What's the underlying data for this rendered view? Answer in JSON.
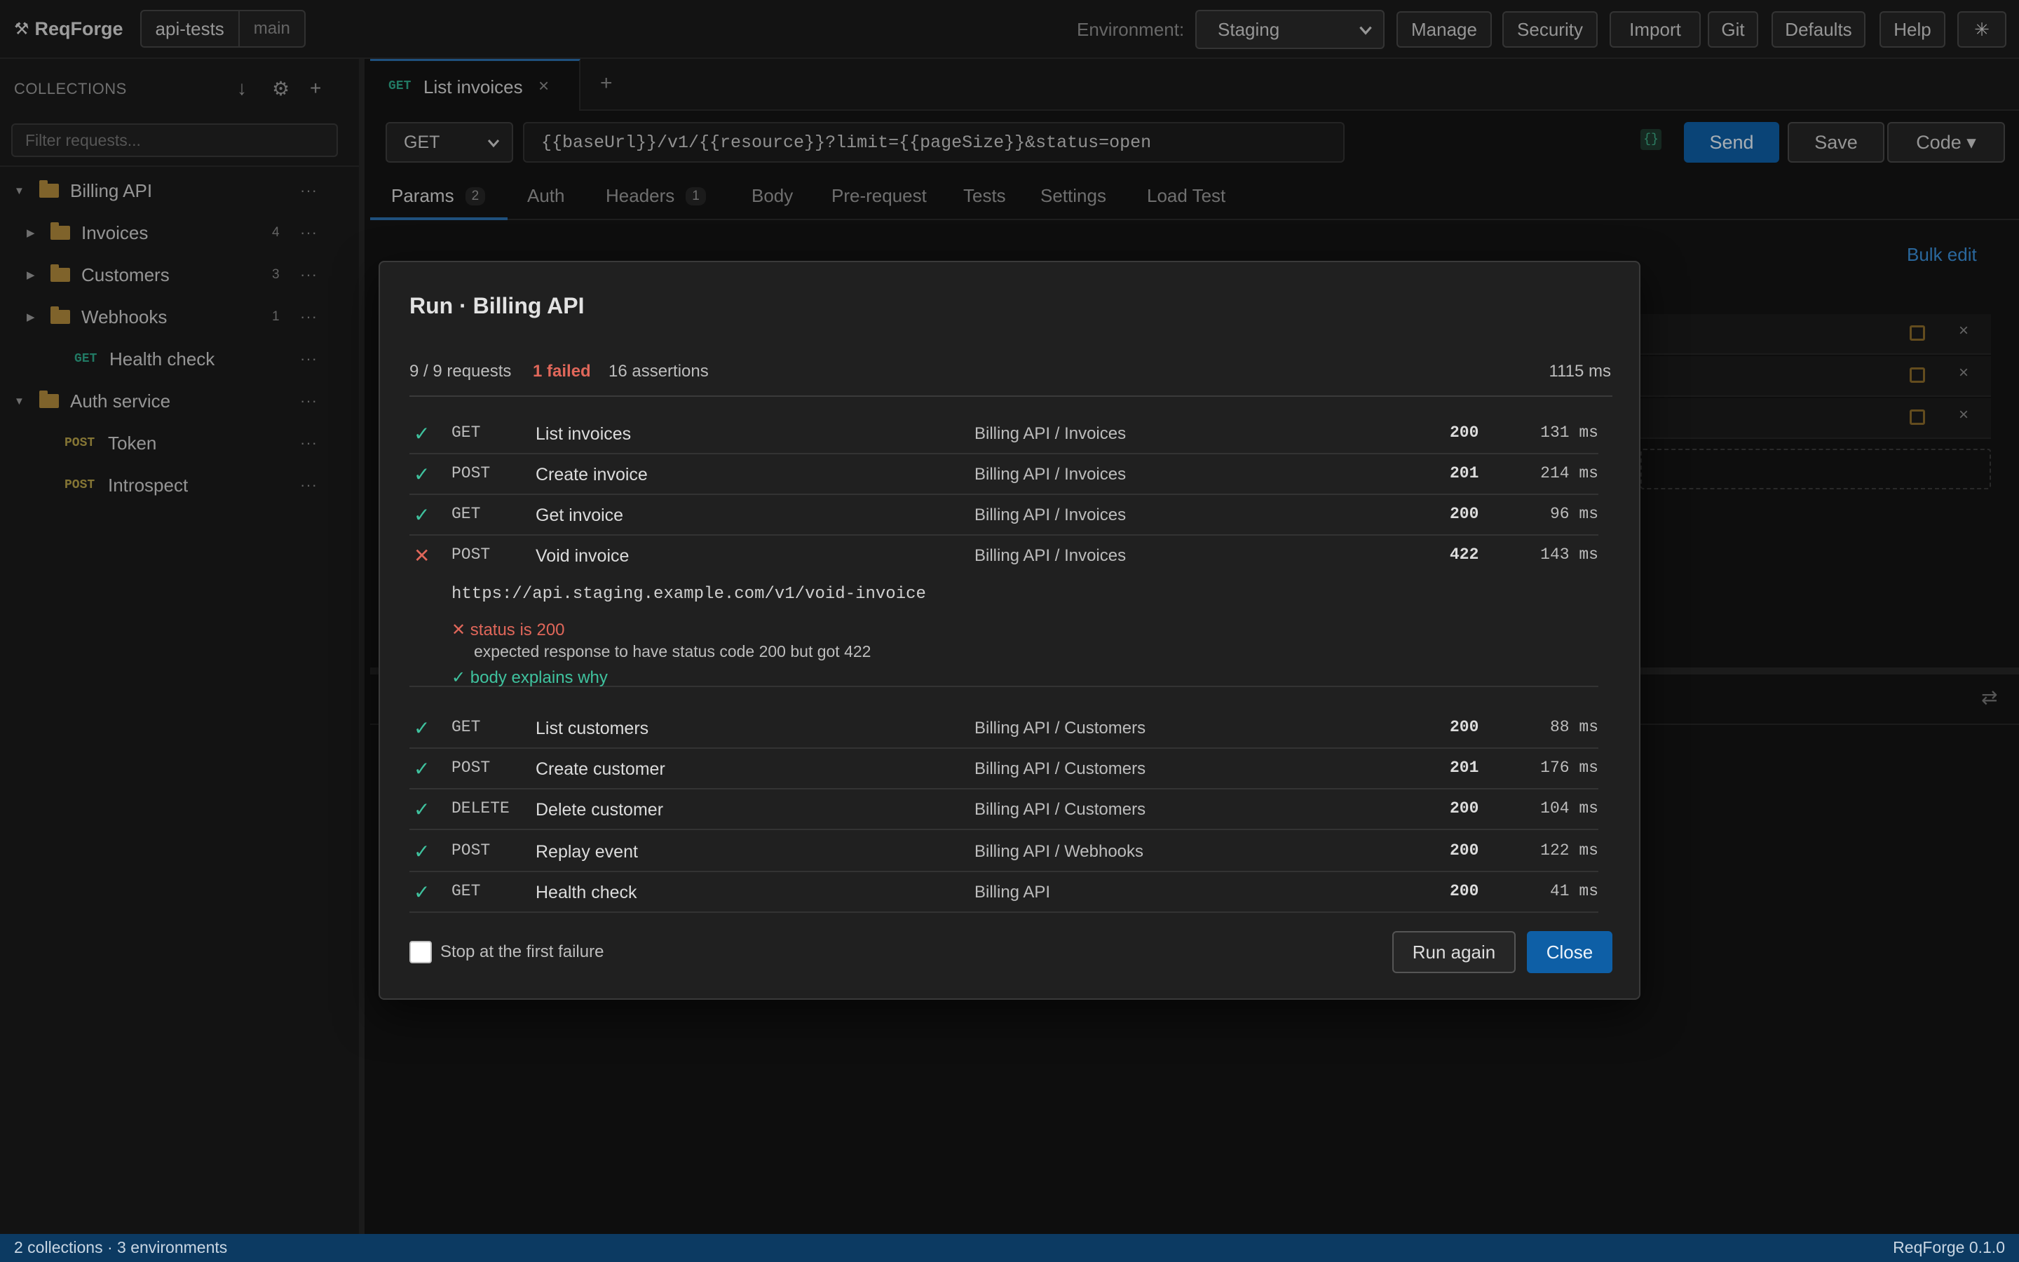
{
  "app": {
    "name": "ReqForge",
    "workspace": "api-tests",
    "branch": "main"
  },
  "toolbar": {
    "env_label": "Environment:",
    "env_value": "Staging",
    "buttons": [
      "Manage",
      "Security",
      "Import",
      "Git",
      "Defaults",
      "Help"
    ],
    "theme_icon": "sun-icon"
  },
  "sidebar": {
    "heading": "COLLECTIONS",
    "filter_placeholder": "Filter requests...",
    "tree": [
      {
        "type": "folder",
        "label": "Billing API",
        "expanded": true
      },
      {
        "type": "folder",
        "label": "Invoices",
        "count": "4",
        "expanded": false
      },
      {
        "type": "folder",
        "label": "Customers",
        "count": "3",
        "expanded": false
      },
      {
        "type": "folder",
        "label": "Webhooks",
        "count": "1",
        "expanded": false
      },
      {
        "type": "request",
        "method": "GET",
        "label": "Health check"
      },
      {
        "type": "folder",
        "label": "Auth service",
        "expanded": true
      },
      {
        "type": "request",
        "method": "POST",
        "label": "Token"
      },
      {
        "type": "request",
        "method": "POST",
        "label": "Introspect"
      }
    ]
  },
  "request_tab": {
    "method": "GET",
    "name": "List invoices",
    "close": "×",
    "add": "+"
  },
  "urlbar": {
    "method": "GET",
    "url": "{{baseUrl}}/v1/{{resource}}?limit={{pageSize}}&status=open",
    "var_badge": "{}",
    "send": "Send",
    "save": "Save",
    "code": "Code ▾"
  },
  "subtabs": [
    {
      "label": "Params",
      "badge": "2"
    },
    {
      "label": "Auth"
    },
    {
      "label": "Headers",
      "badge": "1"
    },
    {
      "label": "Body"
    },
    {
      "label": "Pre-request"
    },
    {
      "label": "Tests"
    },
    {
      "label": "Settings"
    },
    {
      "label": "Load Test"
    }
  ],
  "params": {
    "bulk_edit": "Bulk edit"
  },
  "modal": {
    "title": "Run · Billing API",
    "requests_summary": "9 / 9 requests",
    "failed_summary": "1 failed",
    "assertions_summary": "16 assertions",
    "total_time": "1115 ms",
    "rows": [
      {
        "status": "pass",
        "method": "GET",
        "name": "List invoices",
        "path": "Billing API / Invoices",
        "code": "200",
        "time": "131 ms"
      },
      {
        "status": "pass",
        "method": "POST",
        "name": "Create invoice",
        "path": "Billing API / Invoices",
        "code": "201",
        "time": "214 ms"
      },
      {
        "status": "pass",
        "method": "GET",
        "name": "Get invoice",
        "path": "Billing API / Invoices",
        "code": "200",
        "time": "96 ms"
      },
      {
        "status": "fail",
        "method": "POST",
        "name": "Void invoice",
        "path": "Billing API / Invoices",
        "code": "422",
        "time": "143 ms"
      },
      {
        "status": "pass",
        "method": "GET",
        "name": "List customers",
        "path": "Billing API / Customers",
        "code": "200",
        "time": "88 ms"
      },
      {
        "status": "pass",
        "method": "POST",
        "name": "Create customer",
        "path": "Billing API / Customers",
        "code": "201",
        "time": "176 ms"
      },
      {
        "status": "pass",
        "method": "DELETE",
        "name": "Delete customer",
        "path": "Billing API / Customers",
        "code": "200",
        "time": "104 ms"
      },
      {
        "status": "pass",
        "method": "POST",
        "name": "Replay event",
        "path": "Billing API / Webhooks",
        "code": "200",
        "time": "122 ms"
      },
      {
        "status": "pass",
        "method": "GET",
        "name": "Health check",
        "path": "Billing API",
        "code": "200",
        "time": "41 ms"
      }
    ],
    "failure": {
      "url": "https://api.staging.example.com/v1/void-invoice",
      "assertion_fail": "✕ status is 200",
      "assertion_fail_msg": "expected response to have status code 200 but got 422",
      "assertion_pass": "✓ body explains why"
    },
    "stop_on_failure_label": "Stop at the first failure",
    "stop_on_failure_checked": false,
    "run_again": "Run again",
    "close": "Close"
  },
  "statusbar": {
    "left": "2 collections · 3 environments",
    "right": "ReqForge 0.1.0"
  },
  "colors": {
    "accent": "#0e5fa6",
    "pass": "#3fc29e",
    "fail": "#e0675a",
    "get": "#2fa88a",
    "post": "#b8a248",
    "statusbar": "#0c3a62"
  }
}
